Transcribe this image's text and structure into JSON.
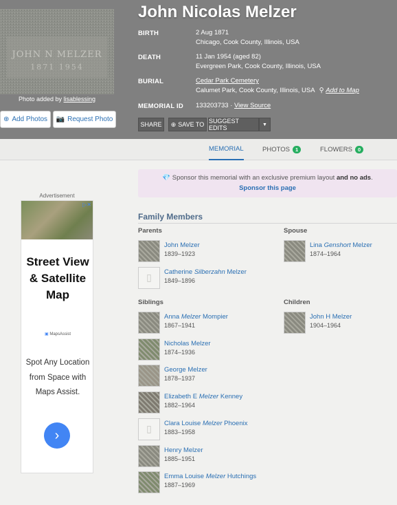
{
  "memorial": {
    "name": "John Nicolas Melzer",
    "photo_credit_prefix": "Photo added by",
    "photo_credit_user": "lisablessing",
    "add_photos": "Add Photos",
    "request_photo": "Request Photo",
    "birth_label": "BIRTH",
    "birth_date": "2 Aug 1871",
    "birth_place": "Chicago, Cook County, Illinois, USA",
    "death_label": "DEATH",
    "death_date": "11 Jan 1954 (aged 82)",
    "death_place": "Evergreen Park, Cook County, Illinois, USA",
    "burial_label": "BURIAL",
    "burial_cemetery": "Cedar Park Cemetery",
    "burial_place": "Calumet Park, Cook County, Illinois, USA",
    "add_to_map": "Add to Map",
    "memorial_id_label": "MEMORIAL ID",
    "memorial_id": "133203733",
    "view_source": "View Source",
    "share": "SHARE",
    "save_to": "SAVE TO",
    "suggest_edits": "SUGGEST EDITS",
    "gravestone_text": "JOHN N MELZER 1871 1954"
  },
  "tabs": [
    {
      "label": "MEMORIAL"
    },
    {
      "label": "PHOTOS",
      "count": "1"
    },
    {
      "label": "FLOWERS",
      "count": "0"
    }
  ],
  "ad": {
    "label": "Advertisement",
    "headline": "Street View & Satellite Map",
    "brand": "MapsAssist",
    "body": "Spot Any Location from Space with Maps Assist."
  },
  "sponsor": {
    "text_before": "Sponsor this memorial with an exclusive premium layout",
    "text_bold": "and no ads",
    "link": "Sponsor this page"
  },
  "family": {
    "title": "Family Members",
    "parents_label": "Parents",
    "spouse_label": "Spouse",
    "siblings_label": "Siblings",
    "children_label": "Children",
    "parents": [
      {
        "first": "John",
        "maiden": "",
        "last": "Melzer",
        "dates": "1839–1923",
        "has_photo": true
      },
      {
        "first": "Catherine",
        "maiden": "Silberzahn",
        "last": "Melzer",
        "dates": "1849–1896",
        "has_photo": false
      }
    ],
    "spouse": [
      {
        "first": "Lina",
        "maiden": "Genshort",
        "last": "Melzer",
        "dates": "1874–1964",
        "has_photo": true
      }
    ],
    "siblings": [
      {
        "first": "Anna",
        "maiden": "Melzer",
        "last": "Mompier",
        "dates": "1867–1941",
        "has_photo": true
      },
      {
        "first": "Nicholas",
        "maiden": "",
        "last": "Melzer",
        "dates": "1874–1936",
        "has_photo": true
      },
      {
        "first": "George",
        "maiden": "",
        "last": "Melzer",
        "dates": "1878–1937",
        "has_photo": true
      },
      {
        "first": "Elizabeth E",
        "maiden": "Melzer",
        "last": "Kenney",
        "dates": "1882–1964",
        "has_photo": true
      },
      {
        "first": "Clara Louise",
        "maiden": "Melzer",
        "last": "Phoenix",
        "dates": "1883–1958",
        "has_photo": false
      },
      {
        "first": "Henry",
        "maiden": "",
        "last": "Melzer",
        "dates": "1885–1951",
        "has_photo": true
      },
      {
        "first": "Emma Louise",
        "maiden": "Melzer",
        "last": "Hutchings",
        "dates": "1887–1969",
        "has_photo": true
      }
    ],
    "children": [
      {
        "first": "John H",
        "maiden": "",
        "last": "Melzer",
        "dates": "1904–1964",
        "has_photo": true
      }
    ]
  },
  "colors": {
    "link": "#2a6fb3",
    "hero_bg": "#808080",
    "badge": "#27ae60",
    "sponsor_bg": "#f0e4f0"
  }
}
